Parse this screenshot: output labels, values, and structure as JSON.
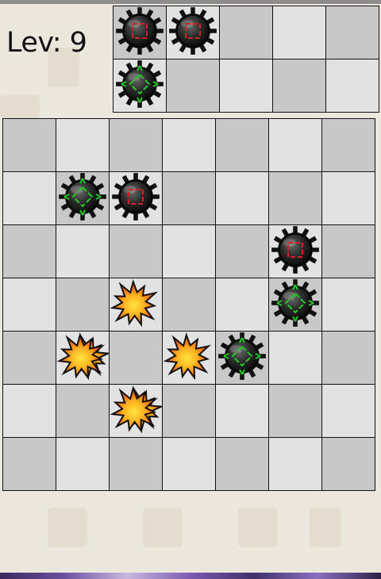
{
  "level": {
    "label": "Lev: 9"
  },
  "colors": {
    "light": "#e2e2e2",
    "dark": "#c8c8c8",
    "red_mark": "#d42020",
    "green_mark": "#22cc22"
  },
  "preview": {
    "rows": 2,
    "cols": 5,
    "pieces": [
      {
        "row": 0,
        "col": 0,
        "type": "mine-red"
      },
      {
        "row": 0,
        "col": 1,
        "type": "mine-red"
      },
      {
        "row": 1,
        "col": 0,
        "type": "mine-green"
      }
    ]
  },
  "board": {
    "rows": 7,
    "cols": 7,
    "pieces": [
      {
        "row": 1,
        "col": 1,
        "type": "mine-green"
      },
      {
        "row": 1,
        "col": 2,
        "type": "mine-red"
      },
      {
        "row": 2,
        "col": 5,
        "type": "mine-red"
      },
      {
        "row": 3,
        "col": 2,
        "type": "explosion"
      },
      {
        "row": 3,
        "col": 5,
        "type": "mine-green"
      },
      {
        "row": 4,
        "col": 1,
        "type": "explosion-double"
      },
      {
        "row": 4,
        "col": 3,
        "type": "explosion"
      },
      {
        "row": 4,
        "col": 4,
        "type": "mine-green"
      },
      {
        "row": 5,
        "col": 2,
        "type": "explosion-double"
      }
    ]
  }
}
